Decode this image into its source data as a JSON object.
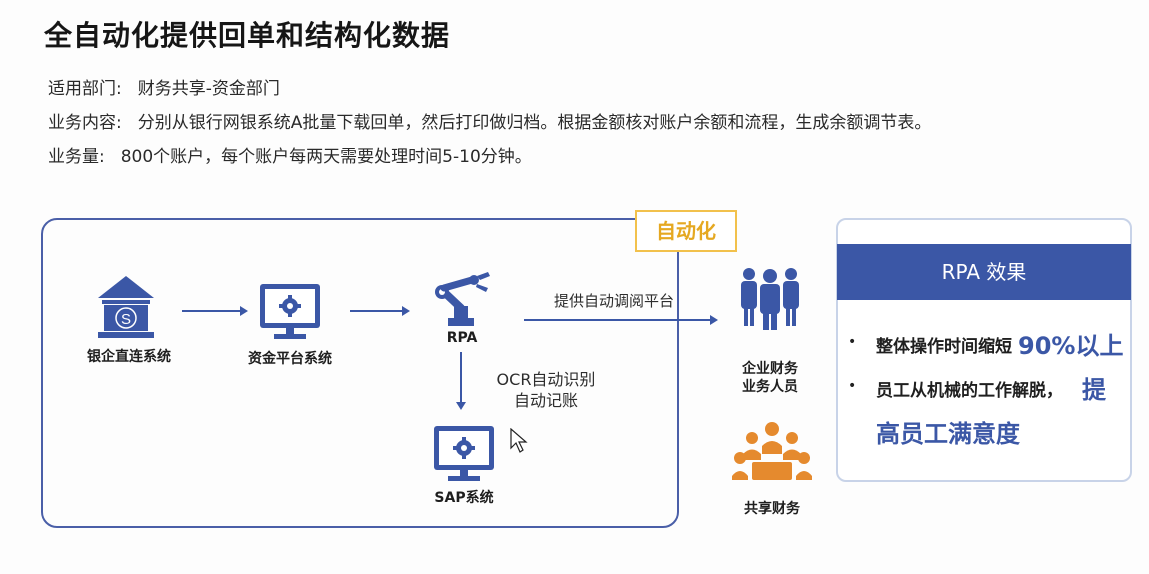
{
  "title": "全自动化提供回单和结构化数据",
  "info": {
    "department_label": "适用部门:",
    "department_value": "财务共享-资金部门",
    "content_label": "业务内容:",
    "content_value": "分别从银行网银系统A批量下载回单，然后打印做归档。根据金额核对账户余额和流程，生成余额调节表。",
    "volume_label": "业务量:",
    "volume_value": "800个账户，每个账户每两天需要处理时间5-10分钟。"
  },
  "flow": {
    "automation_tag": "自动化",
    "bank_system": "银企直连系统",
    "fund_platform": "资金平台系统",
    "rpa": "RPA",
    "review_platform": "提供自动调阅平台",
    "ocr_line1": "OCR自动识别",
    "ocr_line2": "自动记账",
    "sap_system": "SAP系统",
    "finance_staff_line1": "企业财务",
    "finance_staff_line2": "业务人员",
    "shared_finance": "共享财务",
    "bank_icon_letter": "S"
  },
  "result": {
    "header": "RPA 效果",
    "item1_text": "整体操作时间缩短",
    "item1_highlight": "90%以上",
    "item2_text": "员工从机械的工作解脱，",
    "item2_highlight_a": "提",
    "item2_highlight_b": "高员工满意度",
    "bullet": "•"
  },
  "colors": {
    "primary": "#3b57a6",
    "accent": "#e5a821",
    "orange": "#e58a2e"
  }
}
